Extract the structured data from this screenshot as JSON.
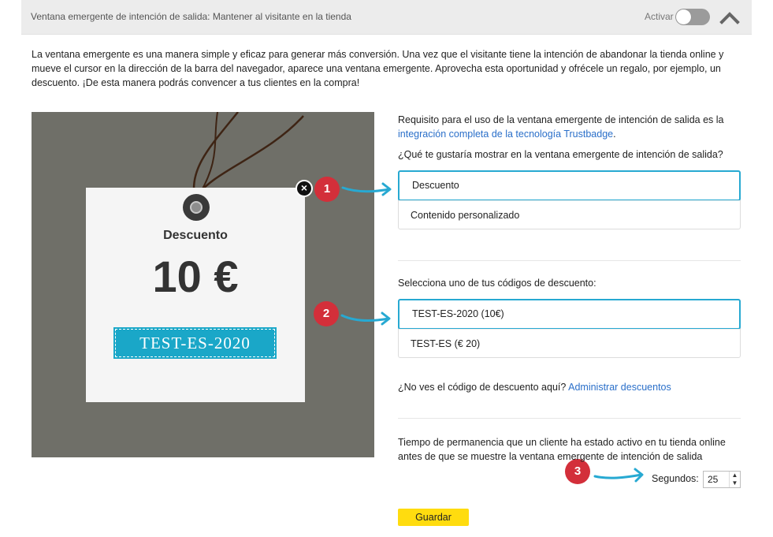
{
  "header": {
    "title": "Ventana emergente de intención de salida: Mantener al visitante en la tienda",
    "toggle_label": "Activar",
    "toggle_on": false,
    "collapse_icon": "chevron-up-icon"
  },
  "intro": {
    "text": "La ventana emergente es una manera simple y eficaz para generar más conversión. Una vez que el visitante tiene la intención de abandonar la tienda online y mueve el cursor en la dirección de la barra del navegador, aparece una ventana emergente. Aprovecha esta oportunidad y ofrécele un regalo, por ejemplo, un descuento. ¡De esta manera podrás convencer a tus clientes en la compra!"
  },
  "preview": {
    "tag_title": "Descuento",
    "tag_amount": "10 €",
    "tag_code": "TEST-ES-2020",
    "close_icon": "close-icon",
    "background_color": "#6f6f68",
    "code_color": "#1aa7c8"
  },
  "annotations": {
    "badge_1": "1",
    "badge_2": "2",
    "badge_3": "3",
    "badge_color": "#d32f3a",
    "arrow_color": "#27a9d2"
  },
  "requirement": {
    "text_before": "Requisito para el uso de la ventana emergente de intención de salida es la ",
    "link": "integración completa de la tecnología Trustbadge",
    "text_after": "."
  },
  "display_question": "¿Qué te gustaría mostrar en la ventana emergente de intención de salida?",
  "display_options": [
    {
      "label": "Descuento",
      "selected": true
    },
    {
      "label": "Contenido personalizado",
      "selected": false
    }
  ],
  "code_question": "Selecciona uno de tus códigos de descuento:",
  "code_options": [
    {
      "label": "TEST-ES-2020 (10€)",
      "selected": true
    },
    {
      "label": "TEST-ES (€ 20)",
      "selected": false
    }
  ],
  "manage": {
    "text": "¿No ves el código de descuento aquí? ",
    "link": "Administrar descuentos"
  },
  "time": {
    "text": "Tiempo de permanencia que un cliente ha estado activo en tu tienda online antes de que se muestre la ventana emergente de intención de salida",
    "seconds_label": "Segundos:",
    "seconds_value": "25"
  },
  "save_label": "Guardar",
  "colors": {
    "accent": "#27a9d2",
    "save_button": "#ffdc0f",
    "link": "#2a6fc9"
  }
}
